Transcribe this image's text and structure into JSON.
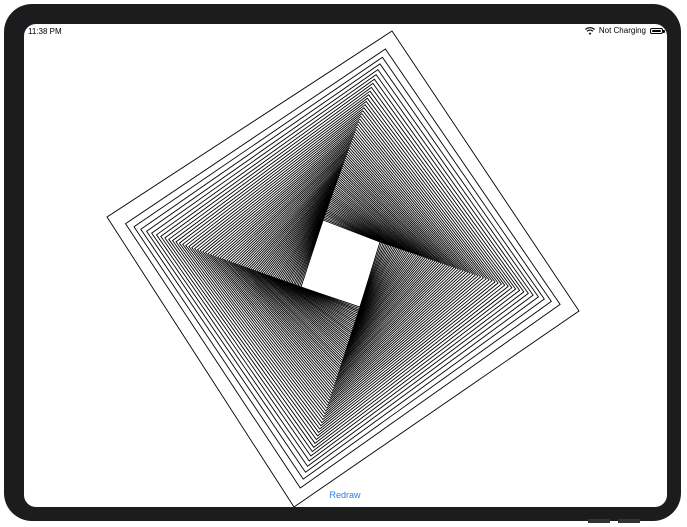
{
  "status_bar": {
    "time": "11:38 PM",
    "wifi_icon": "wifi-icon",
    "battery_status": "Not Charging",
    "battery_icon": "battery-icon"
  },
  "drawing": {
    "shape": "rotating-nested-squares",
    "stroke_color": "#000000",
    "background_color": "#ffffff"
  },
  "toolbar": {
    "redraw_label": "Redraw"
  },
  "colors": {
    "accent": "#2a7ee0",
    "bezel": "#1c1c1e"
  }
}
